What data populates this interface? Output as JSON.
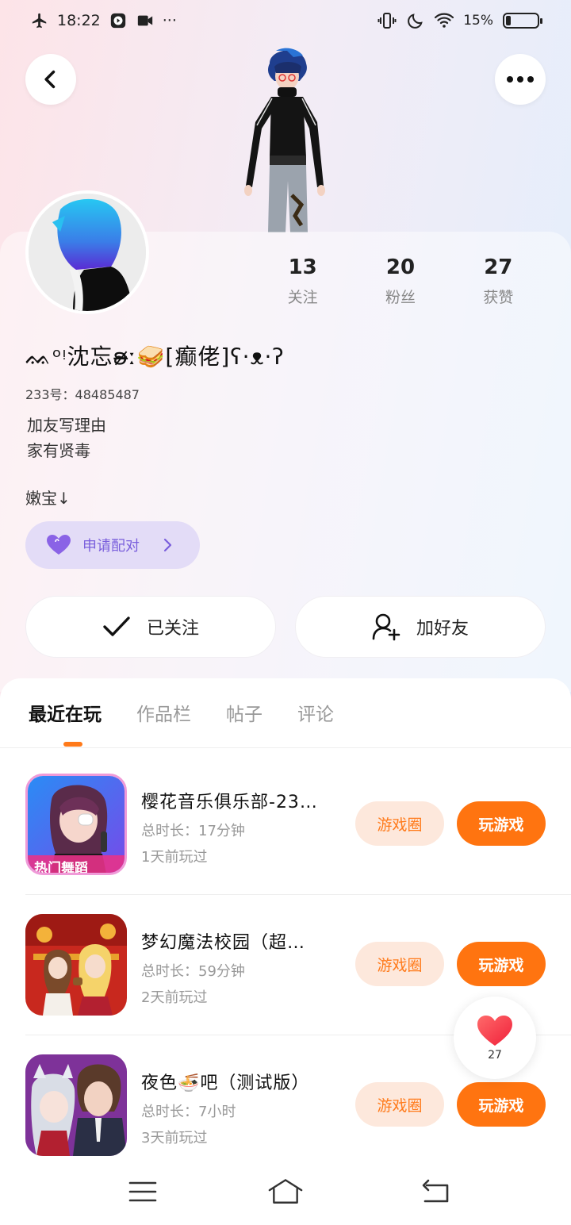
{
  "status_bar": {
    "time": "18:22",
    "more": "···",
    "battery": "15%",
    "icons": [
      "airplane-icon",
      "media-play-icon",
      "video-icon",
      "vibrate-icon",
      "moon-icon",
      "wifi-icon",
      "battery-icon"
    ]
  },
  "header": {
    "back_icon": "chevron-left-icon",
    "more_icon": "more-dots-icon"
  },
  "profile": {
    "stats": [
      {
        "value": "13",
        "label": "关注"
      },
      {
        "value": "20",
        "label": "粉丝"
      },
      {
        "value": "27",
        "label": "获赞"
      }
    ],
    "nickname": "ᨐᵒᵎ沈忘ʚ̴̶̷̷ː🥪[癫佬]ʕ·ᴥ·ʔ",
    "uid": "233号：48485487",
    "bio_line1": "加友写理由",
    "bio_line2": "家有贤毒",
    "tag": "嫩宝↓",
    "pair_button": "申请配对"
  },
  "actions": {
    "follow": "已关注",
    "add_friend": "加好友"
  },
  "tabs": [
    {
      "label": "最近在玩",
      "active": true
    },
    {
      "label": "作品栏",
      "active": false
    },
    {
      "label": "帖子",
      "active": false
    },
    {
      "label": "评论",
      "active": false
    }
  ],
  "games": [
    {
      "title": "樱花音乐俱乐部-23…",
      "duration": "总时长：17分钟",
      "last_played": "1天前玩过",
      "circle_label": "游戏圈",
      "play_label": "玩游戏",
      "thumb_badge": "热门舞蹈"
    },
    {
      "title": "梦幻魔法校园（超…",
      "duration": "总时长：59分钟",
      "last_played": "2天前玩过",
      "circle_label": "游戏圈",
      "play_label": "玩游戏"
    },
    {
      "title": "夜色🍜吧（测试版）",
      "duration": "总时长：7小时",
      "last_played": "3天前玩过",
      "circle_label": "游戏圈",
      "play_label": "玩游戏"
    }
  ],
  "like_fab": {
    "count": "27"
  },
  "colors": {
    "accent": "#ff7410",
    "accent_light": "#fde8dc",
    "pair_bg": "#e3dcf7",
    "pair_text": "#7a5fdc"
  }
}
